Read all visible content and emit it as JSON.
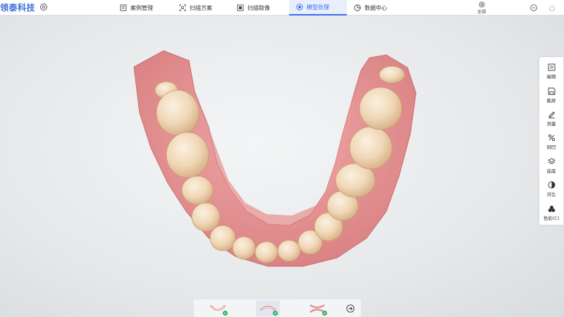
{
  "app": {
    "logo_text": "领泰科技"
  },
  "nav": {
    "tabs": [
      {
        "label": "案例管理",
        "icon": "case-list-icon"
      },
      {
        "label": "扫描方案",
        "icon": "scan-frame-icon"
      },
      {
        "label": "扫描取像",
        "icon": "scan-capture-icon"
      },
      {
        "label": "模型处理",
        "icon": "model-process-icon",
        "active": true
      },
      {
        "label": "数据中心",
        "icon": "pie-chart-icon"
      }
    ],
    "zhengyao_label": "正颌"
  },
  "toolbar": {
    "items": [
      {
        "label": "编辑",
        "icon": "edit-icon"
      },
      {
        "label": "截屏",
        "icon": "screenshot-save-icon"
      },
      {
        "label": "测量",
        "icon": "ruler-pen-icon"
      },
      {
        "label": "倒凹",
        "icon": "percent-undercut-icon"
      },
      {
        "label": "底座",
        "icon": "layers-base-icon"
      },
      {
        "label": "对比",
        "icon": "contrast-icon"
      },
      {
        "label": "色彩(C)",
        "icon": "color-palette-icon"
      }
    ]
  },
  "bottom": {
    "thumbnails": [
      {
        "name": "upper-jaw",
        "checked": true
      },
      {
        "name": "lower-jaw",
        "checked": true,
        "selected": true
      },
      {
        "name": "bite",
        "checked": true
      }
    ]
  },
  "colors": {
    "accent": "#3a6cf0",
    "logo": "#3f6fd8",
    "check": "#27b36b",
    "gum": "#e28a8a",
    "tooth": "#f3dcc0"
  }
}
